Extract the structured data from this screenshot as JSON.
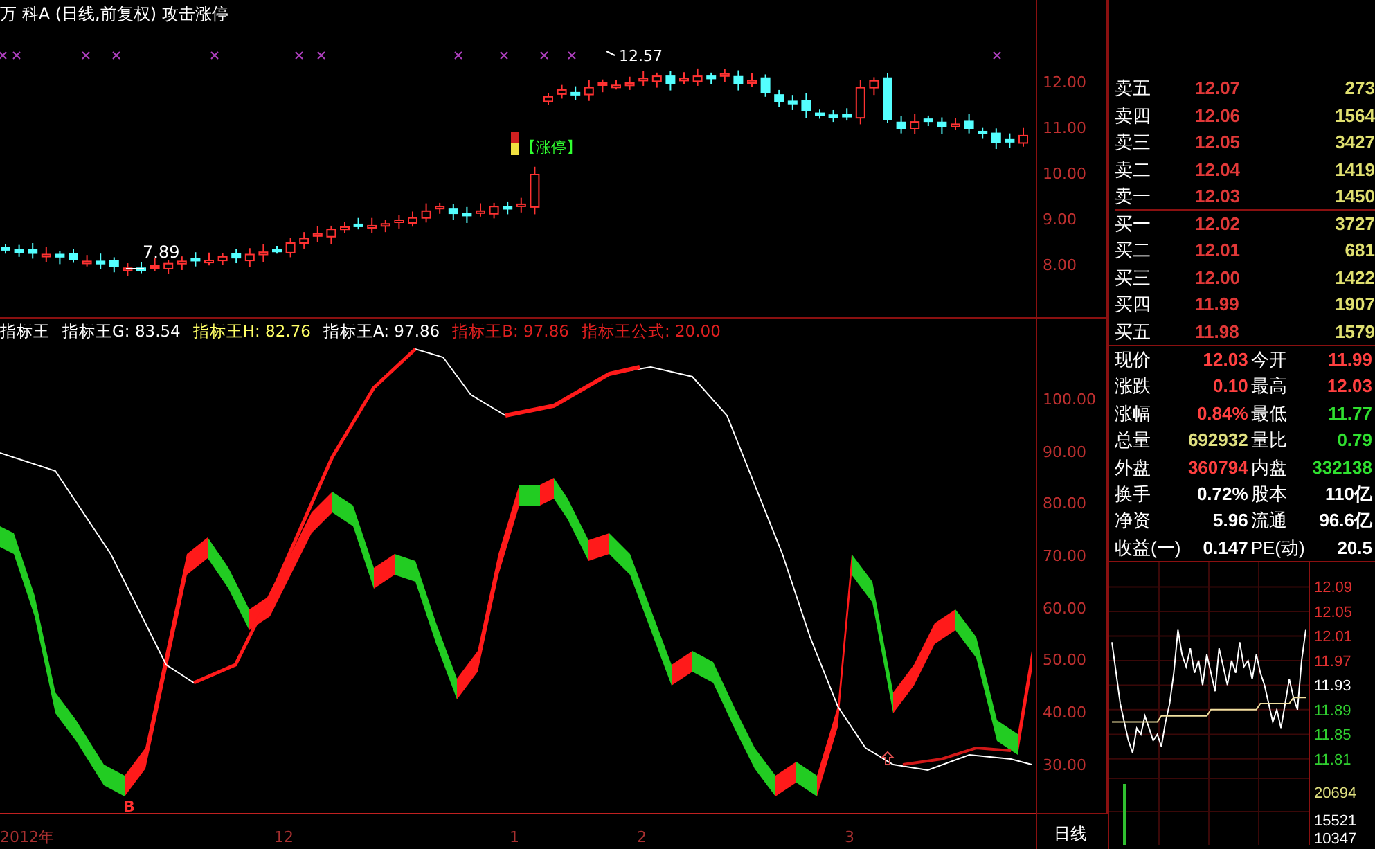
{
  "title": "万 科A (日线,前复权) 攻击涨停",
  "price_chart": {
    "high_label": "12.57",
    "low_label": "7.89",
    "limit_up_tag": "【涨停】",
    "axis_ticks": [
      "12.00",
      "11.00",
      "10.00",
      "9.00",
      "8.00"
    ]
  },
  "indicator": {
    "legend": [
      {
        "text": "指标王",
        "color": "#ffffff"
      },
      {
        "text": "指标王G: 83.54",
        "color": "#ffffff"
      },
      {
        "text": "指标王H: 82.76",
        "color": "#ffff66"
      },
      {
        "text": "指标王A: 97.86",
        "color": "#ffffff"
      },
      {
        "text": "指标王B: 97.86",
        "color": "#e02020"
      },
      {
        "text": "指标王公式: 20.00",
        "color": "#e02020"
      }
    ],
    "axis_ticks": [
      "100.00",
      "90.00",
      "80.00",
      "70.00",
      "60.00",
      "50.00",
      "40.00",
      "30.00"
    ],
    "buy_mark": "B"
  },
  "date_axis": [
    "2012年",
    "12",
    "1",
    "2",
    "3"
  ],
  "period_label": "日线",
  "order_book": [
    {
      "label": "卖五",
      "price": "12.07",
      "volume": "273"
    },
    {
      "label": "卖四",
      "price": "12.06",
      "volume": "1564"
    },
    {
      "label": "卖三",
      "price": "12.05",
      "volume": "3427"
    },
    {
      "label": "卖二",
      "price": "12.04",
      "volume": "1419"
    },
    {
      "label": "卖一",
      "price": "12.03",
      "volume": "1450"
    },
    {
      "label": "买一",
      "price": "12.02",
      "volume": "3727"
    },
    {
      "label": "买二",
      "price": "12.01",
      "volume": "681"
    },
    {
      "label": "买三",
      "price": "12.00",
      "volume": "1422"
    },
    {
      "label": "买四",
      "price": "11.99",
      "volume": "1907"
    },
    {
      "label": "买五",
      "price": "11.98",
      "volume": "1579"
    }
  ],
  "quote_stats": [
    {
      "label": "现价",
      "value": "12.03",
      "color": "#ff4040"
    },
    {
      "label": "今开",
      "value": "11.99",
      "color": "#ff4040"
    },
    {
      "label": "涨跌",
      "value": "0.10",
      "color": "#ff4040"
    },
    {
      "label": "最高",
      "value": "12.03",
      "color": "#ff4040"
    },
    {
      "label": "涨幅",
      "value": "0.84%",
      "color": "#ff4040"
    },
    {
      "label": "最低",
      "value": "11.77",
      "color": "#30e030"
    },
    {
      "label": "总量",
      "value": "692932",
      "color": "#e0e080"
    },
    {
      "label": "量比",
      "value": "0.79",
      "color": "#30e030"
    },
    {
      "label": "外盘",
      "value": "360794",
      "color": "#ff4040"
    },
    {
      "label": "内盘",
      "value": "332138",
      "color": "#30e030"
    },
    {
      "label": "换手",
      "value": "0.72%",
      "color": "#ffffff"
    },
    {
      "label": "股本",
      "value": "110亿",
      "color": "#ffffff"
    },
    {
      "label": "净资",
      "value": "5.96",
      "color": "#ffffff"
    },
    {
      "label": "流通",
      "value": "96.6亿",
      "color": "#ffffff"
    },
    {
      "label": "收益(一)",
      "value": "0.147",
      "color": "#ffffff"
    },
    {
      "label": "PE(动)",
      "value": "20.5",
      "color": "#ffffff"
    }
  ],
  "intraday": {
    "price_ticks": [
      {
        "color": "#e03030"
      },
      {
        "color": "#e03030"
      },
      {
        "color": "#e03030"
      },
      {
        "color": "#e03030"
      },
      {
        "color": "#ffffff"
      },
      {
        "color": "#30d030"
      },
      {
        "color": "#30d030"
      },
      {
        "color": "#30d030"
      }
    ],
    "volume_ticks": [
      {
        "text": "20694",
        "color": "#e0e080"
      },
      {
        "text": "15521",
        "color": "#ffffff"
      },
      {
        "text": "10347",
        "color": "#ffffff"
      }
    ],
    "chart_data": {
      "type": "line",
      "grid": true,
      "ylim": [
        11.67,
        12.13
      ],
      "yticks": [
        {
          "value": 12.09,
          "label": "12.09"
        },
        {
          "value": 12.05,
          "label": "12.05"
        },
        {
          "value": 12.01,
          "label": "12.01"
        },
        {
          "value": 11.97,
          "label": "11.97"
        },
        {
          "value": 11.93,
          "label": "11.93"
        },
        {
          "value": 11.89,
          "label": "11.89"
        },
        {
          "value": 11.85,
          "label": "11.85"
        },
        {
          "value": 11.81,
          "label": "11.81"
        }
      ],
      "series": [
        {
          "color": "#ffffff",
          "values": [
            12.0,
            11.95,
            11.9,
            11.87,
            11.84,
            11.82,
            11.86,
            11.85,
            11.88,
            11.86,
            11.84,
            11.85,
            11.83,
            11.87,
            11.9,
            11.95,
            12.02,
            11.98,
            11.96,
            11.99,
            11.95,
            11.97,
            11.93,
            11.98,
            11.95,
            11.92,
            11.99,
            11.96,
            11.93,
            11.97,
            11.95,
            12.0,
            11.96,
            11.97,
            11.94,
            11.98,
            11.95,
            11.93,
            11.9,
            11.87,
            11.89,
            11.86,
            11.9,
            11.94,
            11.91,
            11.89,
            11.97,
            12.02
          ]
        },
        {
          "color": "#f0e0a0",
          "values": [
            11.87,
            11.87,
            11.87,
            11.87,
            11.87,
            11.87,
            11.87,
            11.87,
            11.87,
            11.87,
            11.87,
            11.87,
            11.88,
            11.88,
            11.88,
            11.88,
            11.88,
            11.88,
            11.88,
            11.88,
            11.88,
            11.88,
            11.88,
            11.88,
            11.89,
            11.89,
            11.89,
            11.89,
            11.89,
            11.89,
            11.89,
            11.89,
            11.89,
            11.89,
            11.89,
            11.89,
            11.9,
            11.9,
            11.9,
            11.9,
            11.9,
            11.9,
            11.9,
            11.9,
            11.91,
            11.91,
            11.91,
            11.91
          ]
        }
      ]
    }
  }
}
